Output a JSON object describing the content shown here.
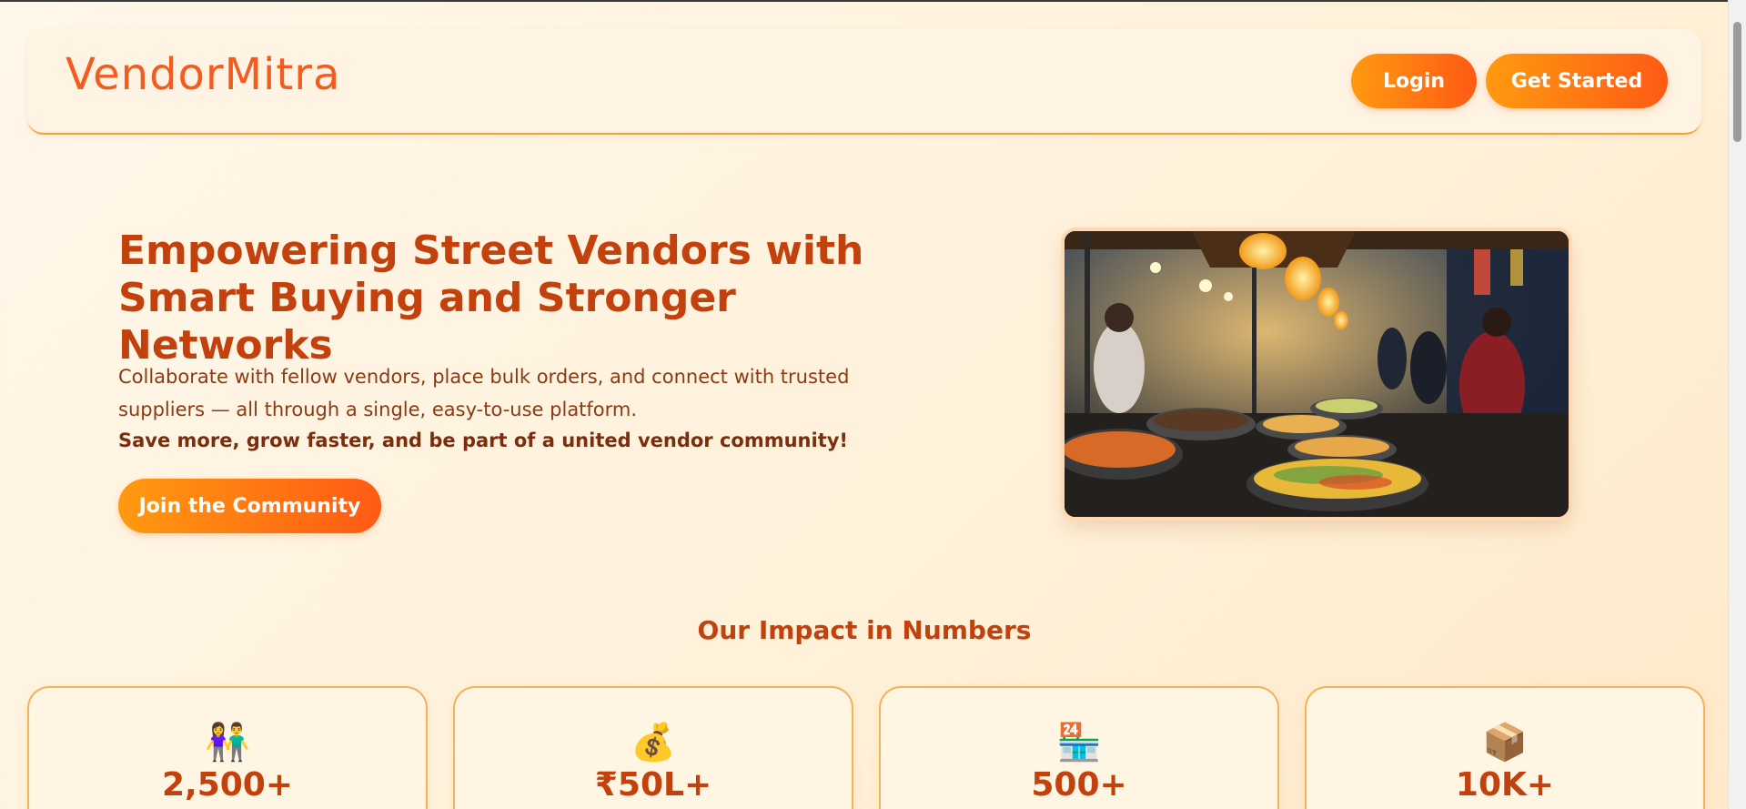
{
  "nav": {
    "logo": "VendorMitra",
    "login_label": "Login",
    "get_started_label": "Get Started"
  },
  "hero": {
    "title_line1": "Empowering Street Vendors with",
    "title_line2": "Smart Buying and Stronger Networks",
    "description": "Collaborate with fellow vendors, place bulk orders, and connect with trusted suppliers — all through a single, easy-to-use platform.",
    "tagline": "Save more, grow faster, and be part of a united vendor community!",
    "cta_label": "Join the Community"
  },
  "impact": {
    "title": "Our Impact in Numbers",
    "stats": [
      {
        "icon": "👫",
        "icon_name": "people-icon",
        "value": "2,500+"
      },
      {
        "icon": "💰",
        "icon_name": "money-bag-icon",
        "value": "₹50L+"
      },
      {
        "icon": "🏪",
        "icon_name": "store-icon",
        "value": "500+"
      },
      {
        "icon": "📦",
        "icon_name": "package-icon",
        "value": "10K+"
      }
    ]
  },
  "colors": {
    "accent": "#ff7a14",
    "heading": "#c2410c",
    "logo": "#f25c1e"
  }
}
